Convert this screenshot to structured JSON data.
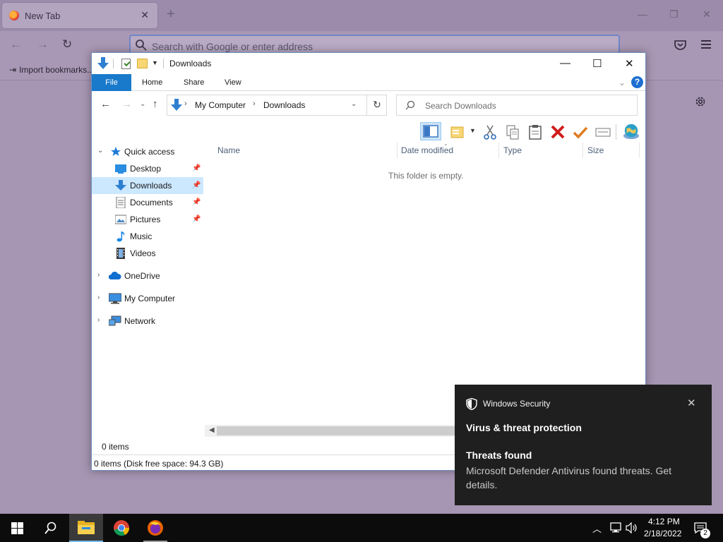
{
  "browser": {
    "tab_title": "New Tab",
    "url_placeholder": "Search with Google or enter address",
    "bookmark_import": "Import bookmarks..."
  },
  "explorer": {
    "window_title": "Downloads",
    "ribbon_tabs": [
      "File",
      "Home",
      "Share",
      "View"
    ],
    "breadcrumb": [
      "My Computer",
      "Downloads"
    ],
    "search_placeholder": "Search Downloads",
    "columns": [
      "Name",
      "Date modified",
      "Type",
      "Size"
    ],
    "empty_message": "This folder is empty.",
    "nav": {
      "quick_access": "Quick access",
      "quick_items": [
        "Desktop",
        "Downloads",
        "Documents",
        "Pictures",
        "Music",
        "Videos"
      ],
      "onedrive": "OneDrive",
      "computer": "My Computer",
      "network": "Network",
      "selected": "Downloads"
    },
    "items_count": "0 items",
    "status": "0 items (Disk free space: 94.3 GB)"
  },
  "toast": {
    "app_name": "Windows Security",
    "title": "Virus & threat protection",
    "subtitle": "Threats found",
    "body": "Microsoft Defender Antivirus found threats. Get details."
  },
  "taskbar": {
    "time": "4:12 PM",
    "date": "2/18/2022",
    "notification_count": "2"
  },
  "colors": {
    "accent": "#1979ca",
    "selection": "#cce8ff",
    "toast_bg": "#1f1f1f"
  }
}
